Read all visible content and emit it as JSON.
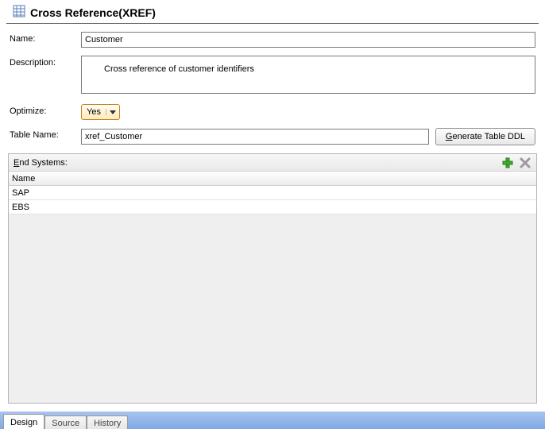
{
  "header": {
    "title": "Cross Reference(XREF)"
  },
  "form": {
    "name_label": "Name:",
    "name_value": "Customer",
    "description_label": "Description:",
    "description_value": "Cross reference of customer identifiers",
    "optimize_label": "Optimize:",
    "optimize_value": "Yes",
    "table_name_label": "Table Name:",
    "table_name_value": "xref_Customer",
    "generate_btn_underline": "G",
    "generate_btn_rest": "enerate Table DDL"
  },
  "end_systems": {
    "title_underline": "E",
    "title_rest": "nd Systems:",
    "column_header": "Name",
    "rows": [
      "SAP",
      "EBS"
    ]
  },
  "tabs": {
    "items": [
      "Design",
      "Source",
      "History"
    ],
    "active_index": 0
  }
}
